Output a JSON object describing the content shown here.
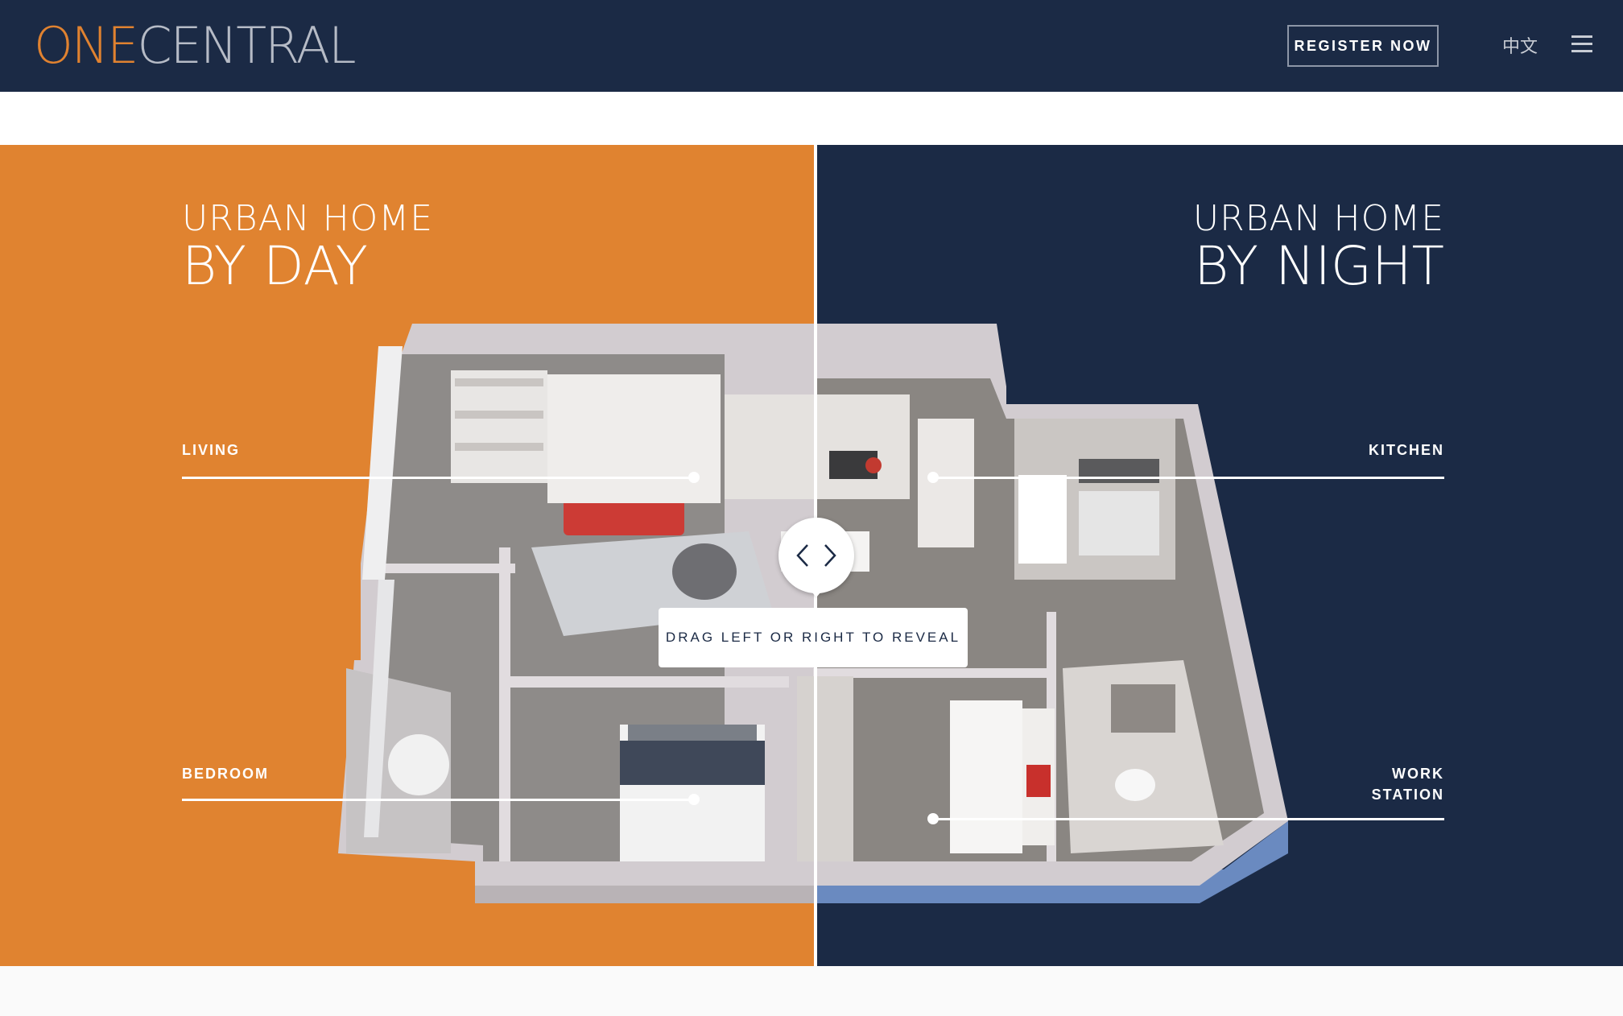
{
  "header": {
    "logo_one": "ONE",
    "logo_central": "CENTRAL",
    "register_label": "REGISTER NOW",
    "language_label": "中文",
    "menu_icon": "hamburger-menu-icon"
  },
  "day_panel": {
    "title_small": "URBAN HOME",
    "title_big": "BY DAY",
    "labels": [
      "LIVING",
      "BEDROOM"
    ],
    "color": "#e08330"
  },
  "night_panel": {
    "title_small": "URBAN HOME",
    "title_big": "BY NIGHT",
    "labels": [
      "KITCHEN",
      "WORK STATION"
    ],
    "color": "#1b2a45"
  },
  "slider": {
    "tooltip": "DRAG LEFT OR RIGHT TO REVEAL",
    "left_icon": "chevron-left-icon",
    "right_icon": "chevron-right-icon"
  }
}
